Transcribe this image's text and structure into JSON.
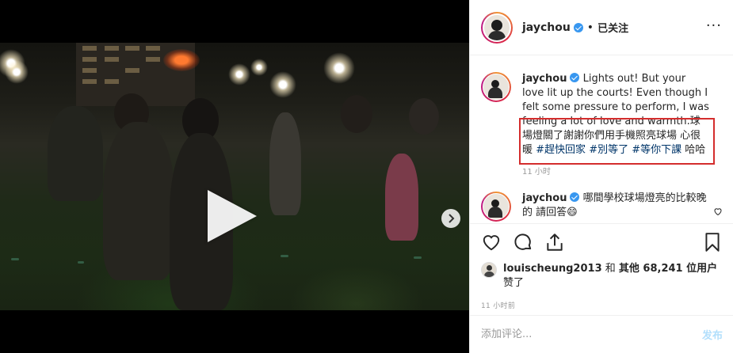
{
  "post": {
    "author": "jaychou",
    "follow_sep": "•",
    "follow_label": "已关注",
    "more_icon": "more-horizontal-icon"
  },
  "media": {
    "play_icon": "play-icon",
    "next_icon": "chevron-right-icon",
    "carousel_total": 2,
    "carousel_active": 1
  },
  "caption": {
    "author": "jaychou",
    "segments": [
      {
        "text": "Lights out! But your love lit up the courts! Even though I felt some pressure to perform, I was feeling a lot of love and warmth.球場燈關了謝謝你們用手機照亮球場 心很暖 ",
        "type": "text"
      },
      {
        "text": "#趕快回家",
        "type": "hashtag"
      },
      {
        "text": " ",
        "type": "text"
      },
      {
        "text": "#別等了",
        "type": "hashtag"
      },
      {
        "text": " ",
        "type": "text"
      },
      {
        "text": "#等你下課",
        "type": "hashtag"
      },
      {
        "text": " 哈哈",
        "type": "text"
      }
    ],
    "time": "11 小时"
  },
  "second_comment": {
    "author": "jaychou",
    "text": "哪間學校球場燈亮的比較晚的 請回答😄"
  },
  "actions": {
    "like_icon": "heart-icon",
    "comment_icon": "comment-icon",
    "share_icon": "share-icon",
    "save_icon": "bookmark-icon"
  },
  "likes": {
    "user": "louischeung2013",
    "middle": " 和 ",
    "others": "其他 68,241 位用户",
    "suffix": "赞了"
  },
  "post_time": "11 小时前",
  "add_comment": {
    "placeholder": "添加评论...",
    "post_label": "发布"
  },
  "colors": {
    "verified": "#3897f0",
    "hashtag": "#003569",
    "highlight_box": "#d42d2d",
    "post_button": "#b2dffc"
  }
}
